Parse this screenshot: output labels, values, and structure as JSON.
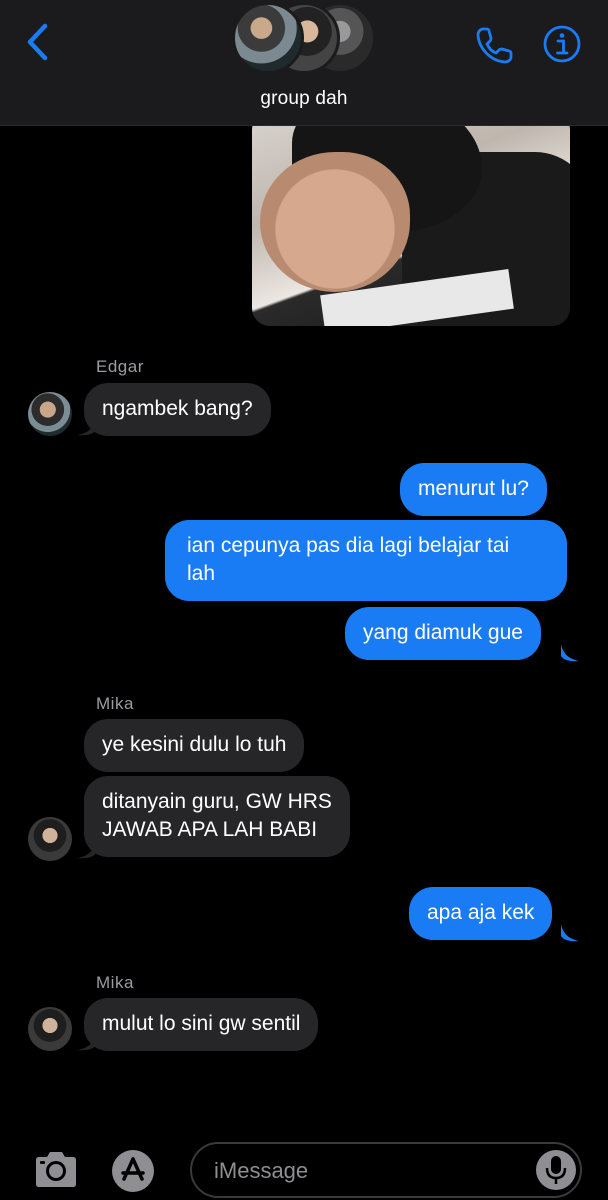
{
  "header": {
    "group_name": "group dah",
    "accent_color": "#1a7cf5"
  },
  "messages": [
    {
      "type": "image",
      "direction": "outgoing"
    },
    {
      "type": "sender",
      "name": "Edgar"
    },
    {
      "type": "text",
      "direction": "incoming",
      "sender": "Edgar",
      "text": "ngambek bang?"
    },
    {
      "type": "text",
      "direction": "outgoing",
      "text": "menurut lu?"
    },
    {
      "type": "text",
      "direction": "outgoing",
      "lines": [
        "ian cepunya pas dia lagi belajar tai",
        "lah"
      ]
    },
    {
      "type": "text",
      "direction": "outgoing",
      "text": "yang diamuk gue"
    },
    {
      "type": "sender",
      "name": "Mika"
    },
    {
      "type": "text",
      "direction": "incoming",
      "sender": "Mika",
      "text": "ye kesini dulu lo tuh"
    },
    {
      "type": "text",
      "direction": "incoming",
      "sender": "Mika",
      "lines": [
        "ditanyain guru, GW HRS",
        "JAWAB APA LAH BABI"
      ]
    },
    {
      "type": "text",
      "direction": "outgoing",
      "text": "apa aja kek"
    },
    {
      "type": "sender",
      "name": "Mika"
    },
    {
      "type": "text",
      "direction": "incoming",
      "sender": "Mika",
      "text": "mulut lo sini gw sentil"
    }
  ],
  "composer": {
    "placeholder": "iMessage"
  },
  "icons": {
    "back": "chevron-left-icon",
    "call": "phone-icon",
    "info": "info-icon",
    "camera": "camera-icon",
    "apps": "app-store-icon",
    "mic": "microphone-icon"
  }
}
